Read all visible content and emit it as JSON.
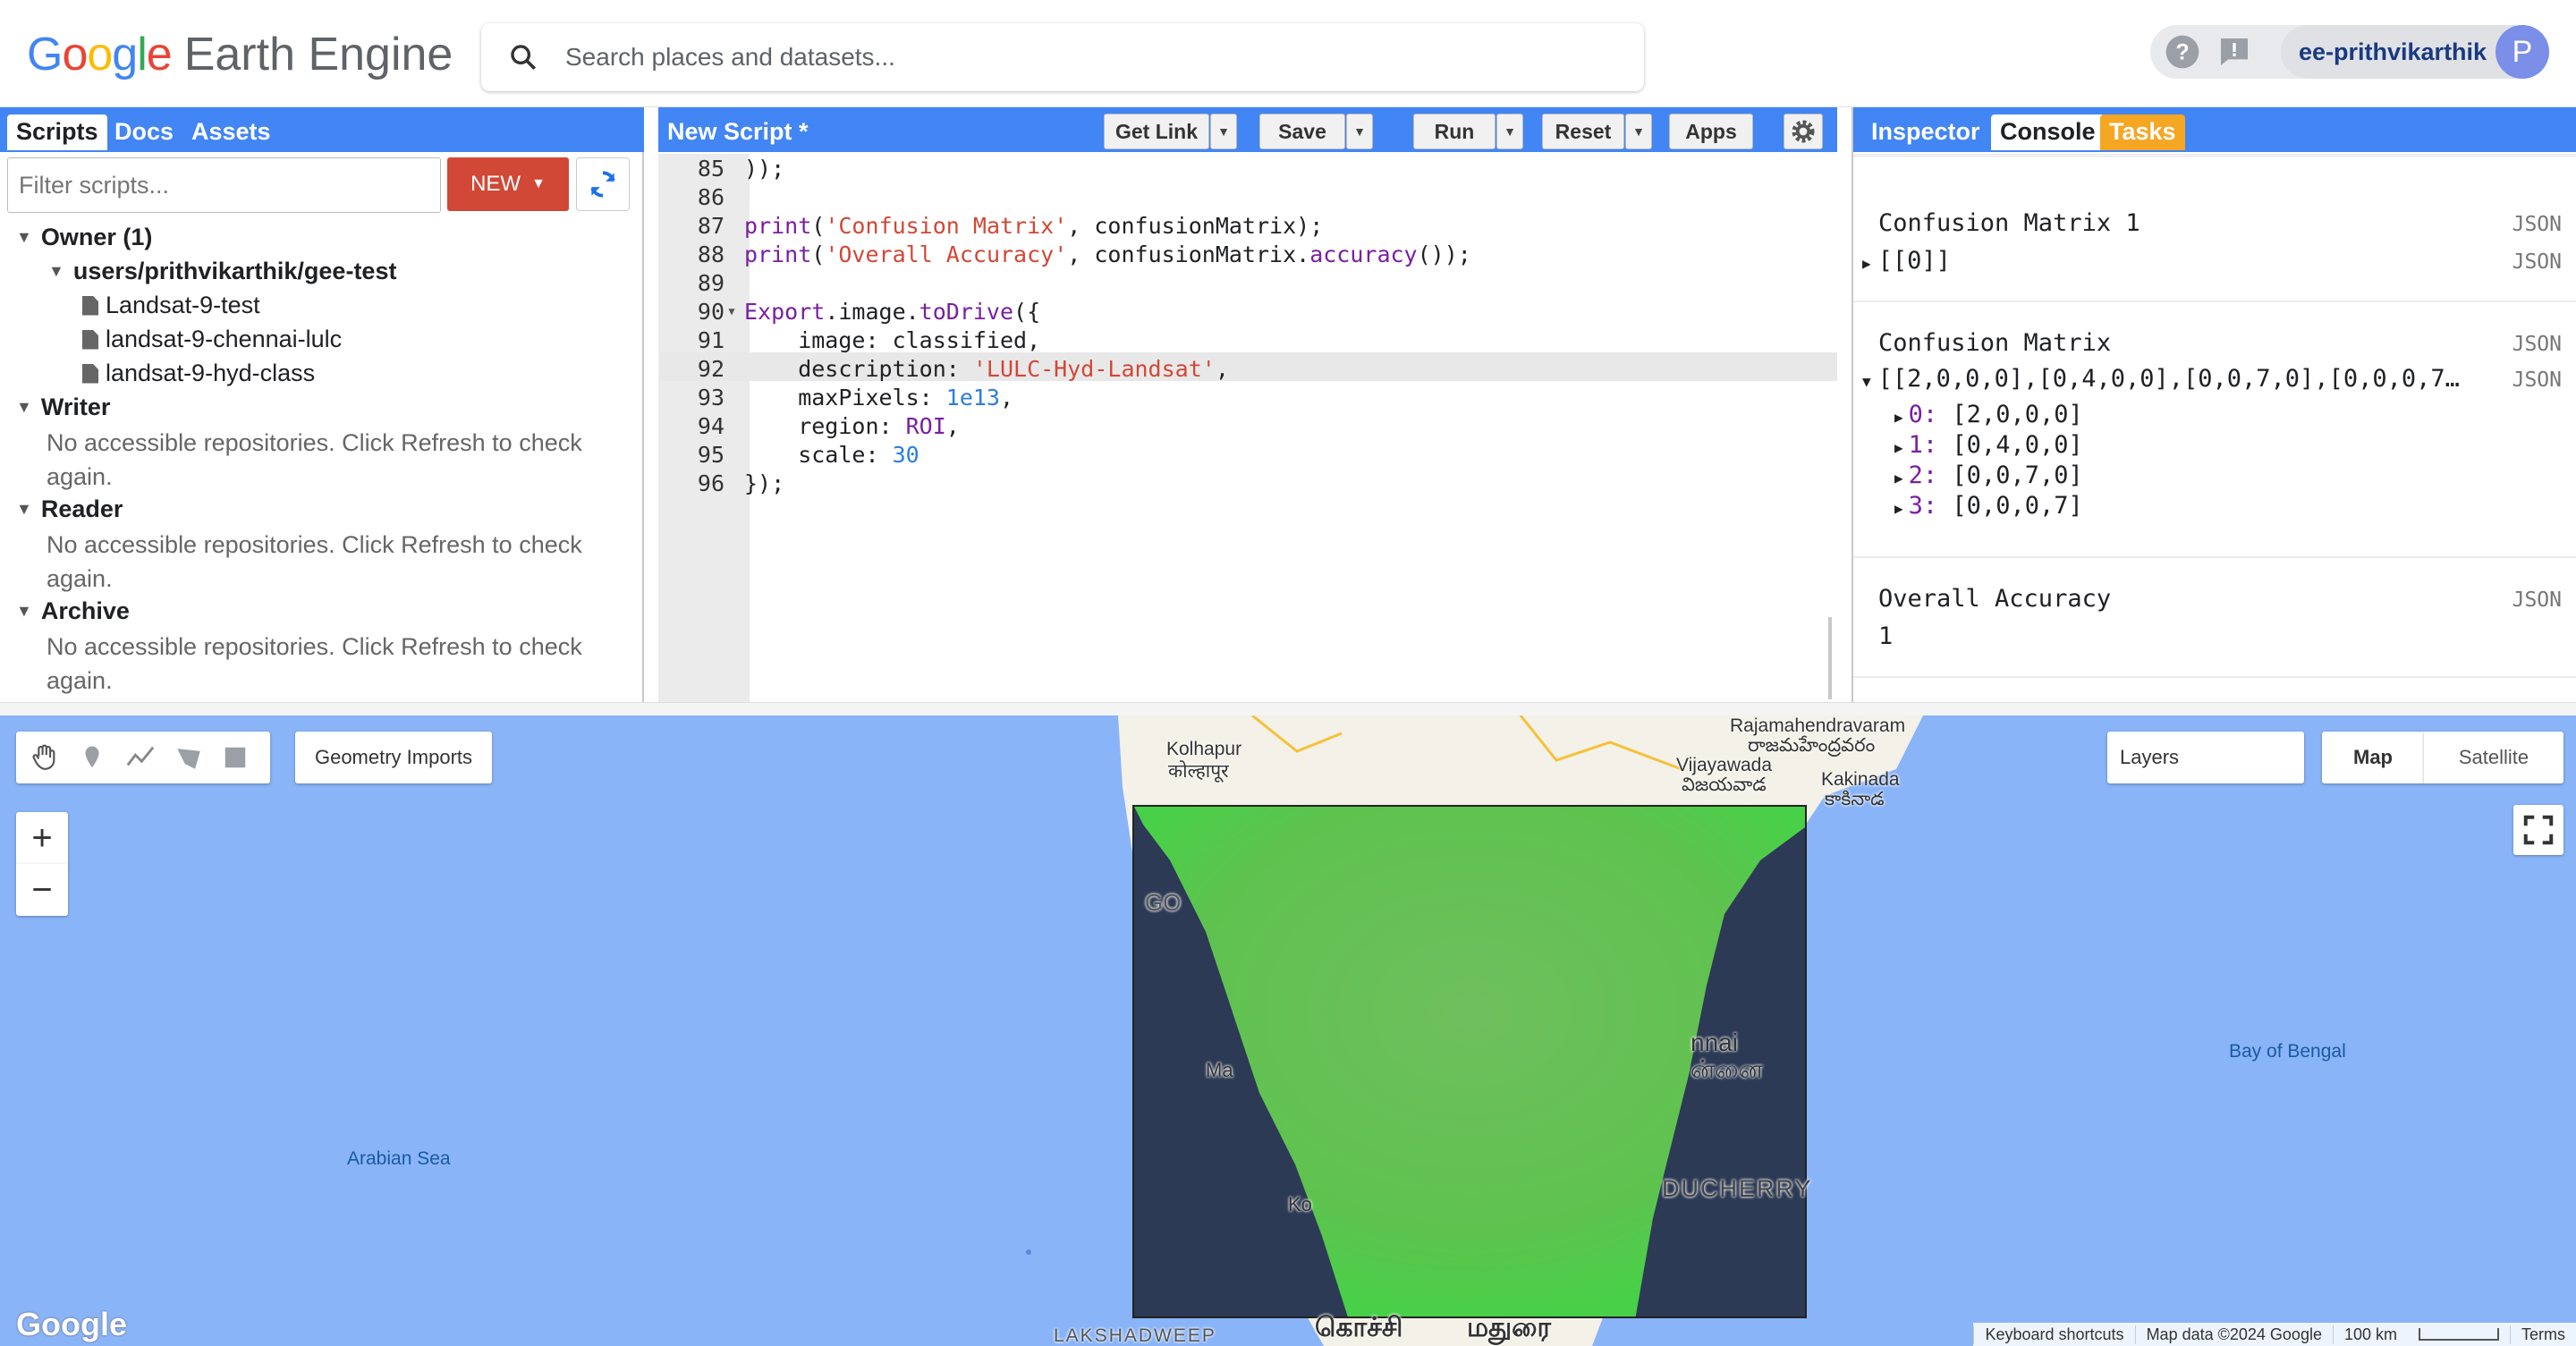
{
  "header": {
    "logo_google": "Google",
    "logo_product": "Earth Engine",
    "search_placeholder": "Search places and datasets...",
    "username": "ee-prithvikarthik",
    "avatar_letter": "P"
  },
  "left_panel": {
    "tabs": [
      "Scripts",
      "Docs",
      "Assets"
    ],
    "filter_placeholder": "Filter scripts...",
    "new_button": "NEW",
    "tree": {
      "owner": "Owner (1)",
      "repo": "users/prithvikarthik/gee-test",
      "files": [
        "Landsat-9-test",
        "landsat-9-chennai-lulc",
        "landsat-9-hyd-class"
      ],
      "writer": "Writer",
      "reader": "Reader",
      "archive": "Archive",
      "no_access": "No accessible repositories. Click Refresh to check again."
    }
  },
  "editor": {
    "title": "New Script *",
    "buttons": {
      "get_link": "Get Link",
      "save": "Save",
      "run": "Run",
      "reset": "Reset",
      "apps": "Apps"
    },
    "lines": [
      {
        "n": "85",
        "code": "));"
      },
      {
        "n": "86",
        "code": ""
      },
      {
        "n": "87",
        "code": "print('Confusion Matrix', confusionMatrix);"
      },
      {
        "n": "88",
        "code": "print('Overall Accuracy', confusionMatrix.accuracy());"
      },
      {
        "n": "89",
        "code": ""
      },
      {
        "n": "90",
        "code": "Export.image.toDrive({"
      },
      {
        "n": "91",
        "code": "    image: classified,"
      },
      {
        "n": "92",
        "code": "    description: 'LULC-Hyd-Landsat',"
      },
      {
        "n": "93",
        "code": "    maxPixels: 1e13,"
      },
      {
        "n": "94",
        "code": "    region: ROI,"
      },
      {
        "n": "95",
        "code": "    scale: 30"
      },
      {
        "n": "96",
        "code": "});"
      }
    ]
  },
  "right_panel": {
    "tabs": [
      "Inspector",
      "Console",
      "Tasks"
    ],
    "json_label": "JSON",
    "cm1_title": "Confusion Matrix 1",
    "cm1_value": "[[0]]",
    "cm_title": "Confusion Matrix",
    "cm_value": "[[2,0,0,0],[0,4,0,0],[0,0,7,0],[0,0,0,7…",
    "cm_rows": [
      {
        "k": "0:",
        "v": "[2,0,0,0]"
      },
      {
        "k": "1:",
        "v": "[0,4,0,0]"
      },
      {
        "k": "2:",
        "v": "[0,0,7,0]"
      },
      {
        "k": "3:",
        "v": "[0,0,0,7]"
      }
    ],
    "acc_title": "Overall Accuracy",
    "acc_value": "1"
  },
  "map": {
    "geometry_imports": "Geometry Imports",
    "layers": "Layers",
    "map_btn": "Map",
    "satellite_btn": "Satellite",
    "zoom_in": "+",
    "zoom_out": "−",
    "labels": {
      "arabian_sea": "Arabian Sea",
      "bay_of_bengal": "Bay of Bengal",
      "lakshadweep": "LAKSHADWEEP",
      "kolhapur": "Kolhapur",
      "kolhapur_local": "कोल्हापूर",
      "rajamahendravaram": "Rajamahendravaram",
      "rajamahendravaram_local": "రాజమహేంద్రవరం",
      "vijayawada": "Vijayawada",
      "vijayawada_local": "విజయవాడ",
      "kakinada": "Kakinada",
      "kakinada_local": "కాకినాడ",
      "kochi_local": "கொச்சி",
      "madurai_local": "மதுரை",
      "chennai_partial": "nnai",
      "chennai_partial_local": "ன்னை",
      "puducherry_partial": "DUCHERRY",
      "goa_partial": "GO",
      "ma_partial": "Ma",
      "ko_partial": "Ko"
    },
    "google_logo": "Google",
    "attribution": [
      "Keyboard shortcuts",
      "Map data ©2024 Google",
      "100 km",
      "Terms"
    ]
  }
}
